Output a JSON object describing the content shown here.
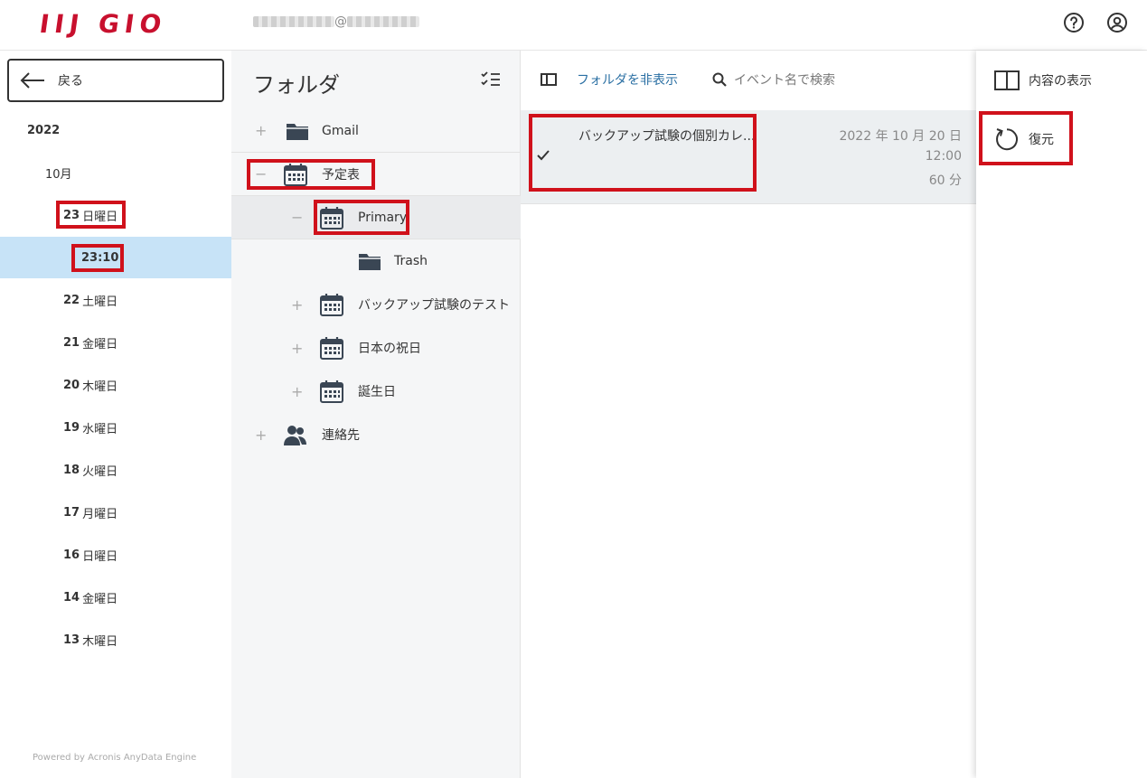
{
  "header": {
    "logo": "IIJ GIO",
    "account_at": "@"
  },
  "left": {
    "back_label": "戻る",
    "year": "2022",
    "month": "10月",
    "dates": [
      {
        "day": "23",
        "weekday": "日曜日"
      },
      {
        "day": "23:10",
        "weekday": ""
      },
      {
        "day": "22",
        "weekday": "土曜日"
      },
      {
        "day": "21",
        "weekday": "金曜日"
      },
      {
        "day": "20",
        "weekday": "木曜日"
      },
      {
        "day": "19",
        "weekday": "水曜日"
      },
      {
        "day": "18",
        "weekday": "火曜日"
      },
      {
        "day": "17",
        "weekday": "月曜日"
      },
      {
        "day": "16",
        "weekday": "日曜日"
      },
      {
        "day": "14",
        "weekday": "金曜日"
      },
      {
        "day": "13",
        "weekday": "木曜日"
      }
    ],
    "powered": "Powered by Acronis AnyData Engine"
  },
  "folders": {
    "title": "フォルダ",
    "items": [
      {
        "toggle": "+",
        "label": "Gmail",
        "icon": "folder-icon"
      },
      {
        "toggle": "−",
        "label": "予定表",
        "icon": "calendar-icon"
      },
      {
        "toggle": "−",
        "label": "Primary",
        "icon": "calendar-icon"
      },
      {
        "toggle": "",
        "label": "Trash",
        "icon": "folder-icon"
      },
      {
        "toggle": "+",
        "label": "バックアップ試験のテスト",
        "icon": "calendar-icon"
      },
      {
        "toggle": "+",
        "label": "日本の祝日",
        "icon": "calendar-icon"
      },
      {
        "toggle": "+",
        "label": "誕生日",
        "icon": "calendar-icon"
      },
      {
        "toggle": "+",
        "label": "連絡先",
        "icon": "contacts-icon"
      }
    ]
  },
  "toolbar": {
    "hide_folder": "フォルダを非表示",
    "search_placeholder": "イベント名で検索"
  },
  "event": {
    "title": "バックアップ試験の個別カレ...",
    "date": "2022 年 10 月 20 日",
    "time": "12:00",
    "duration": "60 分"
  },
  "actions": {
    "show_content": "内容の表示",
    "restore": "復元"
  },
  "colors": {
    "brand": "#c8102e",
    "selected": "#c7e3f7",
    "highlight": "#d0111b",
    "link": "#2a6fa3"
  }
}
